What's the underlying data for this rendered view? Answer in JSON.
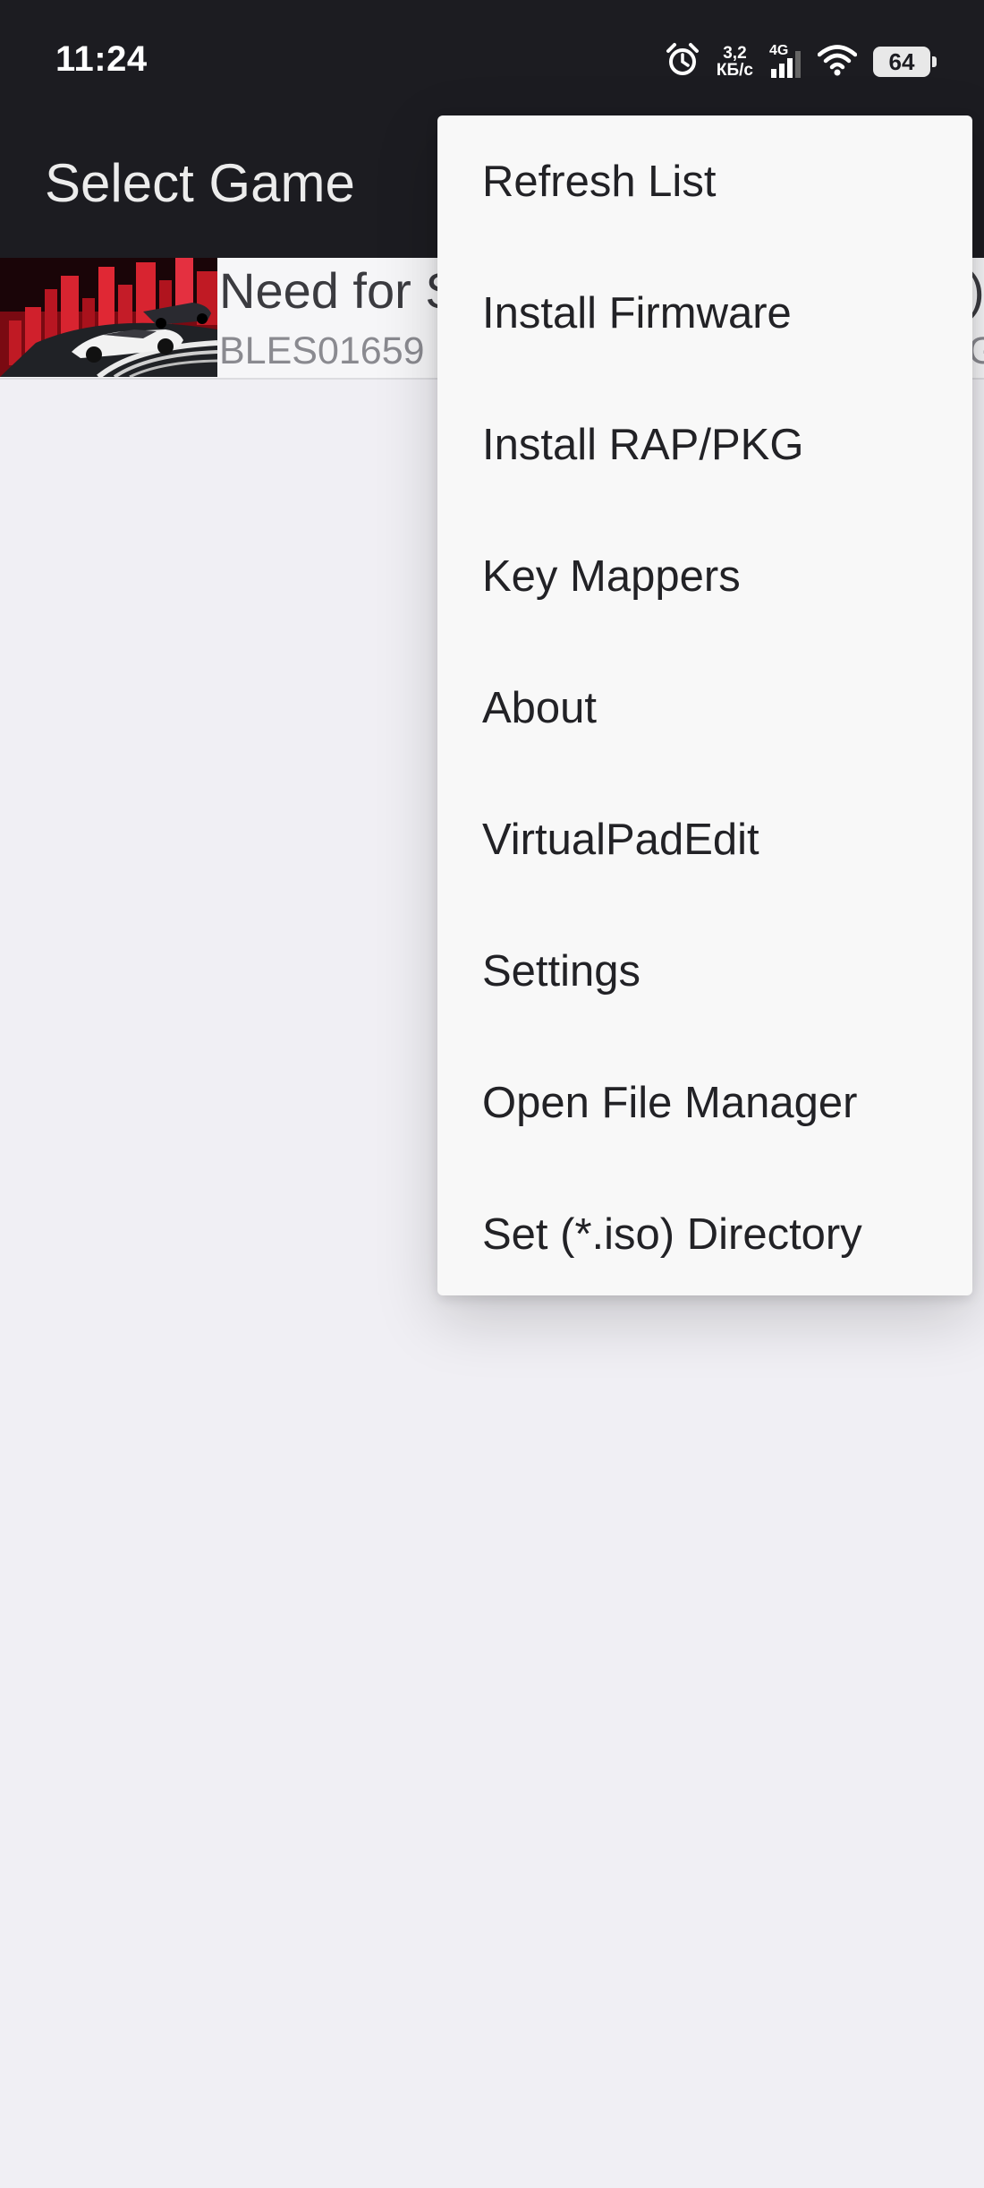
{
  "status_bar": {
    "time": "11:24",
    "net_speed_value": "3,2",
    "net_speed_unit": "КБ/с",
    "network_type": "4G",
    "battery": "64",
    "icons": [
      "alarm-icon",
      "signal-icon",
      "wifi-icon",
      "battery-icon"
    ]
  },
  "toolbar": {
    "title": "Select Game"
  },
  "game_list": [
    {
      "title": "Need for S",
      "title_tail": ")",
      "id": "BLES01659",
      "id_tail": "G"
    }
  ],
  "menu": {
    "items": [
      {
        "label": "Refresh List"
      },
      {
        "label": "Install Firmware"
      },
      {
        "label": "Install RAP/PKG"
      },
      {
        "label": "Key Mappers"
      },
      {
        "label": "About"
      },
      {
        "label": "VirtualPadEdit"
      },
      {
        "label": "Settings"
      },
      {
        "label": "Open File Manager"
      },
      {
        "label": "Set (*.iso) Directory"
      }
    ]
  },
  "colors": {
    "toolbar_bg": "#1c1c21",
    "page_bg": "#f0eff4",
    "menu_bg": "#f8f8f8"
  }
}
